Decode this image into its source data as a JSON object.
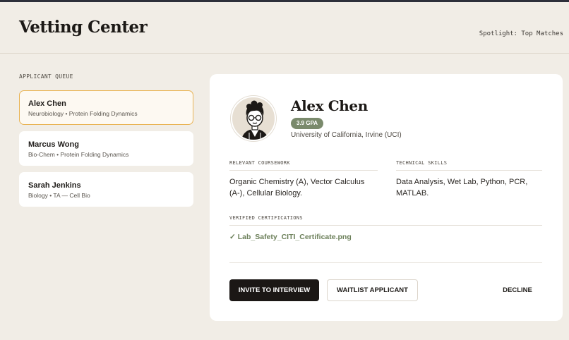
{
  "header": {
    "title": "Vetting Center",
    "spotlight": "Spotlight: Top Matches"
  },
  "queue": {
    "label": "APPLICANT QUEUE",
    "items": [
      {
        "name": "Alex Chen",
        "meta": "Neurobiology • Protein Folding Dynamics",
        "selected": true
      },
      {
        "name": "Marcus Wong",
        "meta": "Bio-Chem • Protein Folding Dynamics",
        "selected": false
      },
      {
        "name": "Sarah Jenkins",
        "meta": "Biology • TA — Cell Bio",
        "selected": false
      }
    ]
  },
  "profile": {
    "name": "Alex Chen",
    "gpa": "3.9 GPA",
    "school": "University of California, Irvine (UCI)",
    "avatar_icon": "person-glasses-icon",
    "coursework_label": "RELEVANT COURSEWORK",
    "coursework": "Organic Chemistry (A), Vector Calculus (A-), Cellular Biology.",
    "skills_label": "TECHNICAL SKILLS",
    "skills": "Data Analysis, Wet Lab, Python, PCR, MATLAB.",
    "cert_label": "VERIFIED CERTIFICATIONS",
    "cert_file": "✓ Lab_Safety_CITI_Certificate.png"
  },
  "actions": {
    "invite": "INVITE TO INTERVIEW",
    "waitlist": "WAITLIST APPLICANT",
    "decline": "DECLINE"
  },
  "colors": {
    "background": "#f1ede6",
    "accent_border": "#e9b455",
    "gpa_badge": "#7a8a6c",
    "primary_button": "#1b1715"
  }
}
